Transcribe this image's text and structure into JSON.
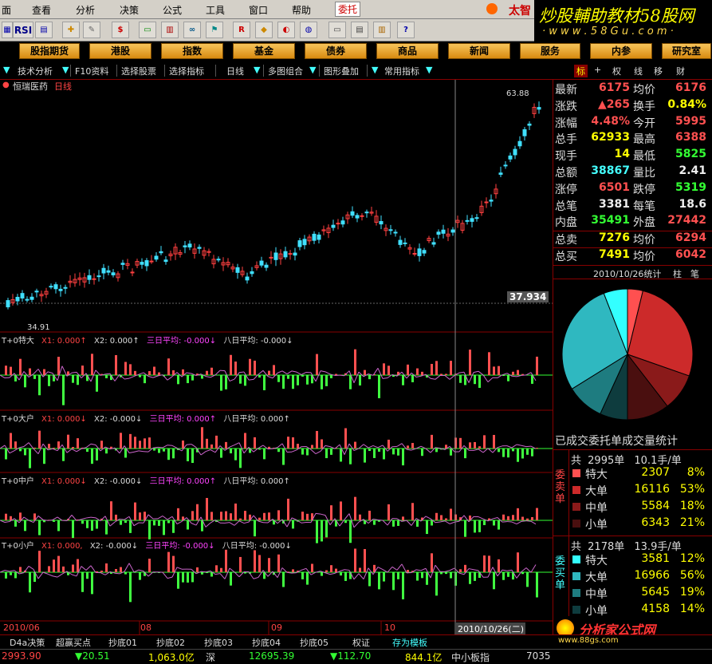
{
  "menu": {
    "items": [
      "面",
      "查看",
      "分析",
      "决策",
      "公式",
      "工具",
      "窗口",
      "帮助"
    ],
    "entrust": "委托",
    "brand": "太智"
  },
  "watermark": {
    "title": "炒股輔助教材58股网",
    "url": "· w w w . 5 8 G u . c o m ·"
  },
  "toolbar": {
    "rsi_label": "RSI"
  },
  "nav": {
    "items": [
      "股指期货",
      "港股",
      "指数",
      "基金",
      "债券",
      "商品",
      "新闻",
      "服务",
      "内参",
      "研究室"
    ]
  },
  "subtool": {
    "items": [
      "技术分析",
      "F10资料",
      "选择股票",
      "选择指标",
      "日线",
      "多图组合",
      "图形叠加",
      "常用指标"
    ],
    "tabs": [
      "标",
      "+",
      "权",
      "线",
      "移",
      "财"
    ]
  },
  "chart": {
    "stock_title": "恒瑞医药",
    "period": "日线",
    "price_high_label": "63.88",
    "price_low_label": "34.91",
    "current_price_label": "37.934",
    "axis_dates": [
      "2010/06",
      "08",
      "09",
      "10"
    ],
    "cursor_date": "2010/10/26(二)"
  },
  "indicators": [
    {
      "name": "T+0特大",
      "x1": "X1: 0.000↑",
      "x2": "X2: 0.000↑",
      "avg3": "三日平均: -0.000↓",
      "avg8": "八日平均: -0.000↓"
    },
    {
      "name": "T+0大户",
      "x1": "X1: 0.000↓",
      "x2": "X2: -0.000↓",
      "avg3": "三日平均: 0.000↑",
      "avg8": "八日平均: 0.000↑"
    },
    {
      "name": "T+0中户",
      "x1": "X1: 0.000↓",
      "x2": "X2: -0.000↓",
      "avg3": "三日平均: 0.000↑",
      "avg8": "八日平均: 0.000↑"
    },
    {
      "name": "T+0小户",
      "x1": "X1: 0.000,",
      "x2": "X2: -0.000↓",
      "avg3": "三日平均: -0.000↓",
      "avg8": "八日平均: -0.000↓"
    }
  ],
  "quote": [
    {
      "l1": "最新",
      "v1": "6175",
      "c1": "red",
      "l2": "均价",
      "v2": "6176",
      "c2": "red"
    },
    {
      "l1": "涨跌",
      "v1": "▲265",
      "c1": "red",
      "l2": "换手",
      "v2": "0.84%",
      "c2": "yellow"
    },
    {
      "l1": "涨幅",
      "v1": "4.48%",
      "c1": "red",
      "l2": "今开",
      "v2": "5995",
      "c2": "red"
    },
    {
      "l1": "总手",
      "v1": "62933",
      "c1": "yellow",
      "l2": "最高",
      "v2": "6388",
      "c2": "red"
    },
    {
      "l1": "现手",
      "v1": "14",
      "c1": "yellow",
      "l2": "最低",
      "v2": "5825",
      "c2": "green"
    },
    {
      "l1": "总额",
      "v1": "38867",
      "c1": "cyan",
      "l2": "量比",
      "v2": "2.41",
      "c2": "white"
    },
    {
      "l1": "涨停",
      "v1": "6501",
      "c1": "red",
      "l2": "跌停",
      "v2": "5319",
      "c2": "green"
    },
    {
      "l1": "总笔",
      "v1": "3381",
      "c1": "white",
      "l2": "每笔",
      "v2": "18.6",
      "c2": "white"
    },
    {
      "l1": "内盘",
      "v1": "35491",
      "c1": "green",
      "l2": "外盘",
      "v2": "27442",
      "c2": "red"
    },
    {
      "l1": "总卖",
      "v1": "7276",
      "c1": "yellow",
      "l2": "均价",
      "v2": "6294",
      "c2": "red"
    },
    {
      "l1": "总买",
      "v1": "7491",
      "c1": "yellow",
      "l2": "均价",
      "v2": "6042",
      "c2": "red"
    }
  ],
  "stats": {
    "date_label": "2010/10/26统计",
    "tab1": "柱",
    "tab2": "笔",
    "section_title": "已成交委托单成交量统计"
  },
  "pie_colors": {
    "sell_big": "#ff5050",
    "sell_large": "#cc2a2a",
    "sell_mid": "#8a1a1a",
    "sell_small": "#4a0f0f",
    "buy_big": "#33ffff",
    "buy_large": "#2fb8c0",
    "buy_mid": "#1e7c80",
    "buy_small": "#0e3c3e"
  },
  "sell_stats": {
    "header_label": "共",
    "header_count": "2995单",
    "header_avg": "10.1手/单",
    "side": "委卖单",
    "rows": [
      {
        "name": "特大",
        "vol": "2307",
        "pct": "8%",
        "color": "#ff5050"
      },
      {
        "name": "大单",
        "vol": "16116",
        "pct": "53%",
        "color": "#cc2a2a"
      },
      {
        "name": "中单",
        "vol": "5584",
        "pct": "18%",
        "color": "#8a1a1a"
      },
      {
        "name": "小单",
        "vol": "6343",
        "pct": "21%",
        "color": "#4a0f0f"
      }
    ]
  },
  "buy_stats": {
    "header_label": "共",
    "header_count": "2178单",
    "header_avg": "13.9手/单",
    "side": "委买单",
    "rows": [
      {
        "name": "特大",
        "vol": "3581",
        "pct": "12%",
        "color": "#33ffff"
      },
      {
        "name": "大单",
        "vol": "16966",
        "pct": "56%",
        "color": "#2fb8c0"
      },
      {
        "name": "中单",
        "vol": "5645",
        "pct": "19%",
        "color": "#1e7c80"
      },
      {
        "name": "小单",
        "vol": "4158",
        "pct": "14%",
        "color": "#0e3c3e"
      }
    ]
  },
  "bottom_tabs": [
    "D4a决策",
    "超赢买点",
    "抄底01",
    "抄底02",
    "抄底03",
    "抄底04",
    "抄底05",
    "权证",
    "存为模板"
  ],
  "status": {
    "sh_index": "2993.90",
    "sh_change": "▼20.51",
    "sh_amount": "1,063.0亿",
    "sz_label": "深",
    "sz_index": "12695.39",
    "sz_change": "▼112.70",
    "sz_amount": "844.1亿",
    "sme_label": "中小板指",
    "sme_index": "7035"
  },
  "footer_brand": {
    "name": "分析家公式网",
    "url": "www.88gs.com"
  }
}
